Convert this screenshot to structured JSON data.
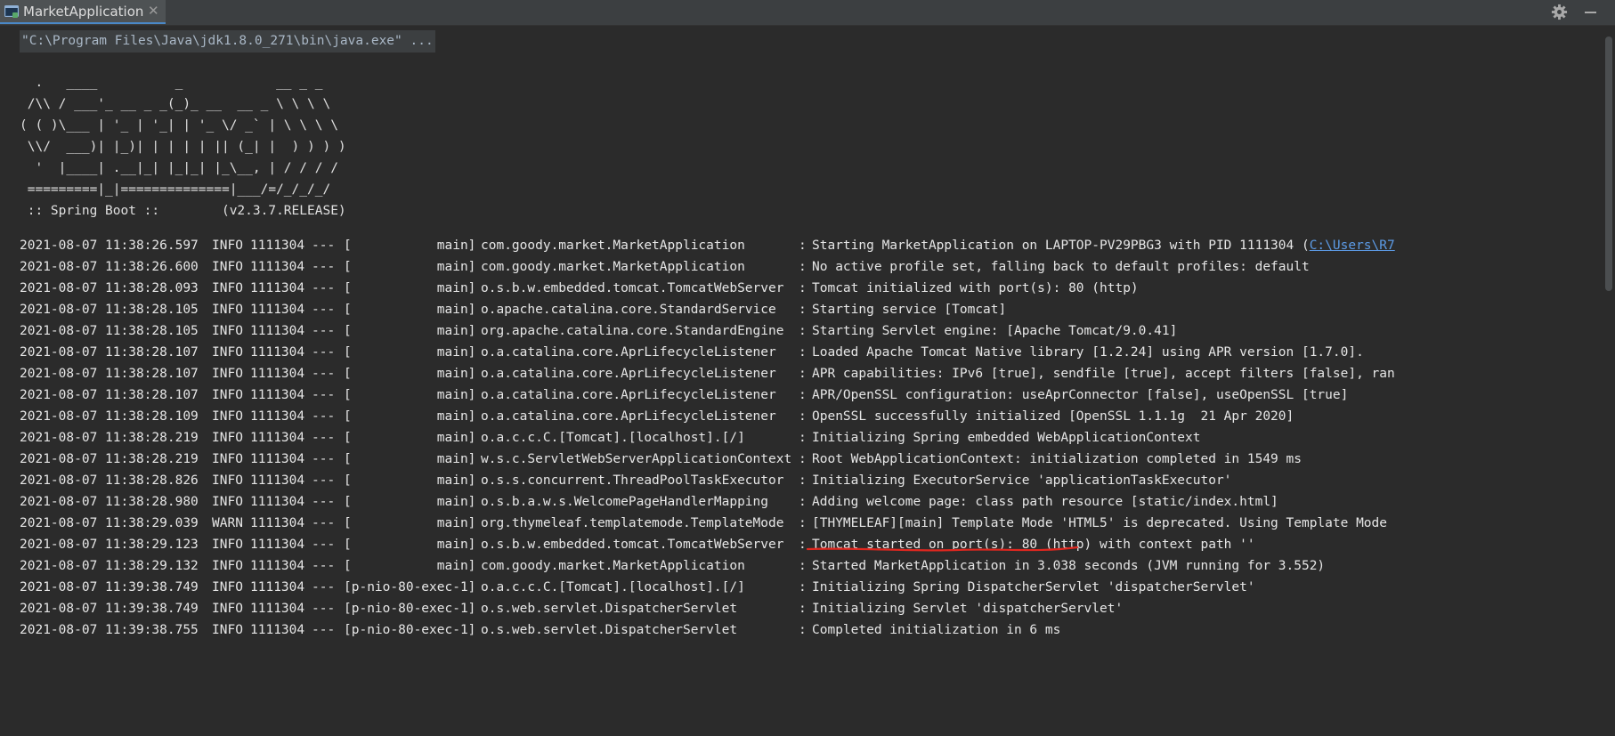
{
  "tab": {
    "title": "MarketApplication",
    "icon": "run-console-icon",
    "close_glyph": "✕"
  },
  "toolbar": {
    "settings_icon": "gear-icon",
    "minimize_icon": "minimize-icon"
  },
  "console": {
    "command": "\"C:\\Program Files\\Java\\jdk1.8.0_271\\bin\\java.exe\" ...",
    "banner": [
      "  .   ____          _            __ _ _",
      " /\\\\ / ___'_ __ _ _(_)_ __  __ _ \\ \\ \\ \\",
      "( ( )\\___ | '_ | '_| | '_ \\/ _` | \\ \\ \\ \\",
      " \\\\/  ___)| |_)| | | | | || (_| |  ) ) ) )",
      "  '  |____| .__|_| |_|_| |_\\__, | / / / /",
      " =========|_|==============|___/=/_/_/_/",
      " :: Spring Boot ::        (v2.3.7.RELEASE)"
    ],
    "logs": [
      {
        "ts": "2021-08-07 11:38:26.597",
        "level": "INFO",
        "pid": "1111304",
        "dash": "---",
        "thread": "[           main]",
        "logger": "com.goody.market.MarketApplication",
        "message": "Starting MarketApplication on LAPTOP-PV29PBG3 with PID 1111304 (",
        "link": "C:\\Users\\R7"
      },
      {
        "ts": "2021-08-07 11:38:26.600",
        "level": "INFO",
        "pid": "1111304",
        "dash": "---",
        "thread": "[           main]",
        "logger": "com.goody.market.MarketApplication",
        "message": "No active profile set, falling back to default profiles: default"
      },
      {
        "ts": "2021-08-07 11:38:28.093",
        "level": "INFO",
        "pid": "1111304",
        "dash": "---",
        "thread": "[           main]",
        "logger": "o.s.b.w.embedded.tomcat.TomcatWebServer",
        "message": "Tomcat initialized with port(s): 80 (http)"
      },
      {
        "ts": "2021-08-07 11:38:28.105",
        "level": "INFO",
        "pid": "1111304",
        "dash": "---",
        "thread": "[           main]",
        "logger": "o.apache.catalina.core.StandardService",
        "message": "Starting service [Tomcat]"
      },
      {
        "ts": "2021-08-07 11:38:28.105",
        "level": "INFO",
        "pid": "1111304",
        "dash": "---",
        "thread": "[           main]",
        "logger": "org.apache.catalina.core.StandardEngine",
        "message": "Starting Servlet engine: [Apache Tomcat/9.0.41]"
      },
      {
        "ts": "2021-08-07 11:38:28.107",
        "level": "INFO",
        "pid": "1111304",
        "dash": "---",
        "thread": "[           main]",
        "logger": "o.a.catalina.core.AprLifecycleListener",
        "message": "Loaded Apache Tomcat Native library [1.2.24] using APR version [1.7.0]."
      },
      {
        "ts": "2021-08-07 11:38:28.107",
        "level": "INFO",
        "pid": "1111304",
        "dash": "---",
        "thread": "[           main]",
        "logger": "o.a.catalina.core.AprLifecycleListener",
        "message": "APR capabilities: IPv6 [true], sendfile [true], accept filters [false], ran"
      },
      {
        "ts": "2021-08-07 11:38:28.107",
        "level": "INFO",
        "pid": "1111304",
        "dash": "---",
        "thread": "[           main]",
        "logger": "o.a.catalina.core.AprLifecycleListener",
        "message": "APR/OpenSSL configuration: useAprConnector [false], useOpenSSL [true]"
      },
      {
        "ts": "2021-08-07 11:38:28.109",
        "level": "INFO",
        "pid": "1111304",
        "dash": "---",
        "thread": "[           main]",
        "logger": "o.a.catalina.core.AprLifecycleListener",
        "message": "OpenSSL successfully initialized [OpenSSL 1.1.1g  21 Apr 2020]"
      },
      {
        "ts": "2021-08-07 11:38:28.219",
        "level": "INFO",
        "pid": "1111304",
        "dash": "---",
        "thread": "[           main]",
        "logger": "o.a.c.c.C.[Tomcat].[localhost].[/]",
        "message": "Initializing Spring embedded WebApplicationContext"
      },
      {
        "ts": "2021-08-07 11:38:28.219",
        "level": "INFO",
        "pid": "1111304",
        "dash": "---",
        "thread": "[           main]",
        "logger": "w.s.c.ServletWebServerApplicationContext",
        "message": "Root WebApplicationContext: initialization completed in 1549 ms"
      },
      {
        "ts": "2021-08-07 11:38:28.826",
        "level": "INFO",
        "pid": "1111304",
        "dash": "---",
        "thread": "[           main]",
        "logger": "o.s.s.concurrent.ThreadPoolTaskExecutor",
        "message": "Initializing ExecutorService 'applicationTaskExecutor'"
      },
      {
        "ts": "2021-08-07 11:38:28.980",
        "level": "INFO",
        "pid": "1111304",
        "dash": "---",
        "thread": "[           main]",
        "logger": "o.s.b.a.w.s.WelcomePageHandlerMapping",
        "message": "Adding welcome page: class path resource [static/index.html]"
      },
      {
        "ts": "2021-08-07 11:38:29.039",
        "level": "WARN",
        "pid": "1111304",
        "dash": "---",
        "thread": "[           main]",
        "logger": "org.thymeleaf.templatemode.TemplateMode",
        "message": "[THYMELEAF][main] Template Mode 'HTML5' is deprecated. Using Template Mode"
      },
      {
        "ts": "2021-08-07 11:38:29.123",
        "level": "INFO",
        "pid": "1111304",
        "dash": "---",
        "thread": "[           main]",
        "logger": "o.s.b.w.embedded.tomcat.TomcatWebServer",
        "message": "Tomcat started on port(s): 80 (http) with context path ''"
      },
      {
        "ts": "2021-08-07 11:38:29.132",
        "level": "INFO",
        "pid": "1111304",
        "dash": "---",
        "thread": "[           main]",
        "logger": "com.goody.market.MarketApplication",
        "message": "Started MarketApplication in 3.038 seconds (JVM running for 3.552)"
      },
      {
        "ts": "2021-08-07 11:39:38.749",
        "level": "INFO",
        "pid": "1111304",
        "dash": "---",
        "thread": "[p-nio-80-exec-1]",
        "logger": "o.a.c.c.C.[Tomcat].[localhost].[/]",
        "message": "Initializing Spring DispatcherServlet 'dispatcherServlet'"
      },
      {
        "ts": "2021-08-07 11:39:38.749",
        "level": "INFO",
        "pid": "1111304",
        "dash": "---",
        "thread": "[p-nio-80-exec-1]",
        "logger": "o.s.web.servlet.DispatcherServlet",
        "message": "Initializing Servlet 'dispatcherServlet'"
      },
      {
        "ts": "2021-08-07 11:39:38.755",
        "level": "INFO",
        "pid": "1111304",
        "dash": "---",
        "thread": "[p-nio-80-exec-1]",
        "logger": "o.s.web.servlet.DispatcherServlet",
        "message": "Completed initialization in 6 ms"
      }
    ],
    "colon": ":",
    "annotation_color": "#e0271f",
    "highlight_line": "Tomcat started on port(s): 80 (http) with context path ''"
  },
  "colors": {
    "background": "#2b2b2b",
    "text": "#e6e6e6",
    "link": "#5c9be6",
    "tab_accent": "#4a88c7"
  }
}
